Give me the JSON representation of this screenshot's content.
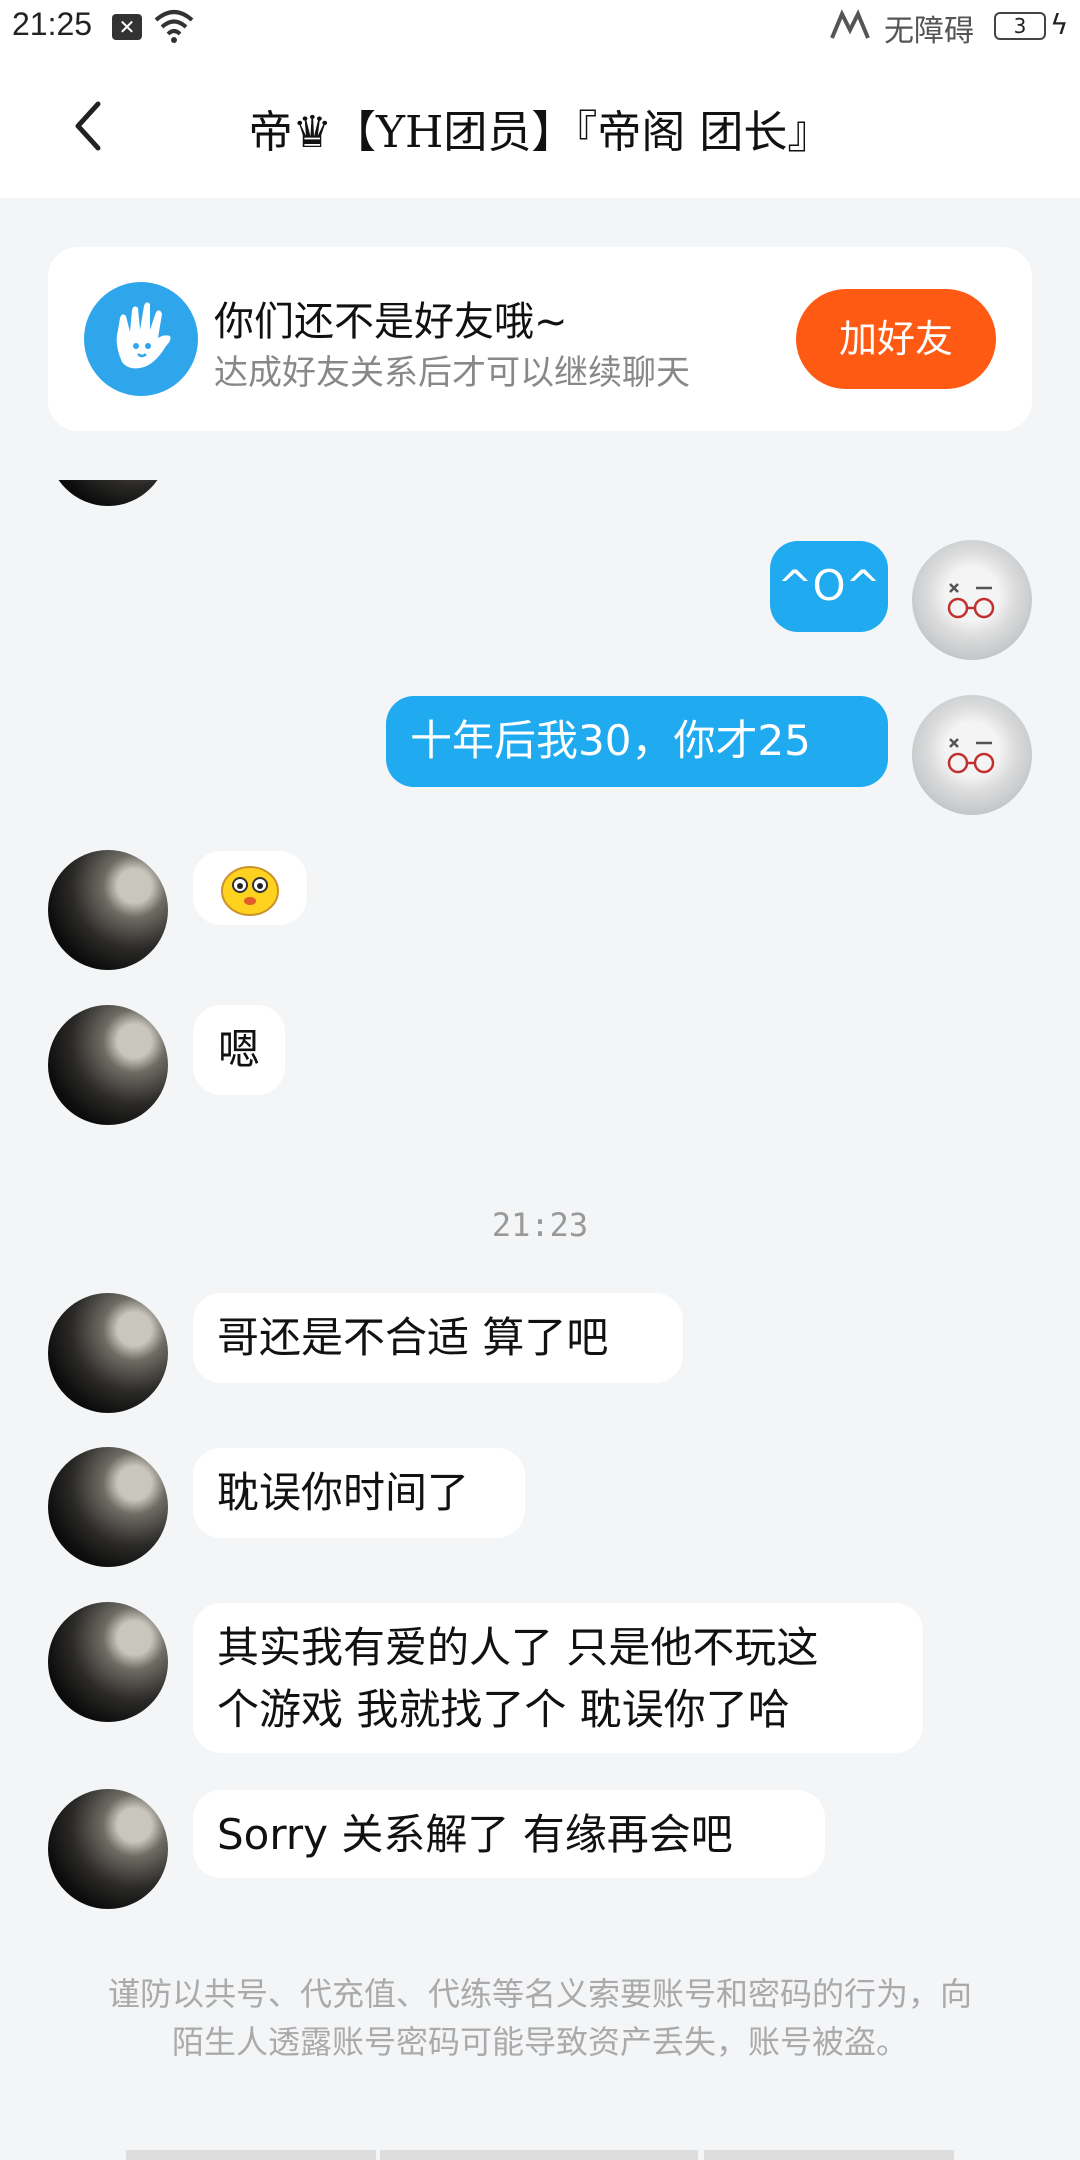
{
  "status_bar": {
    "time": "21:25",
    "notification_glyph": "✕",
    "accessibility_label": "无障碍",
    "battery_level": "3",
    "charging_glyph": "ϟ"
  },
  "header": {
    "title": "帝♛【YH团员】『帝阁 团长』"
  },
  "banner": {
    "title": "你们还不是好友哦~",
    "subtitle": "达成好友关系后才可以继续聊天",
    "add_button": "加好友"
  },
  "messages": [
    {
      "direction": "out",
      "text": "^O^"
    },
    {
      "direction": "out",
      "text": "十年后我30，你才25"
    },
    {
      "direction": "in",
      "text": "",
      "sticker": "yellow-emoji"
    },
    {
      "direction": "in",
      "text": "嗯"
    },
    {
      "direction": "in",
      "text": "哥还是不合适 算了吧"
    },
    {
      "direction": "in",
      "text": "耽误你时间了"
    },
    {
      "direction": "in",
      "text_line1": "其实我有爱的人了 只是他不玩这",
      "text_line2": "个游戏 我就找了个 耽误你了哈"
    },
    {
      "direction": "in",
      "text": "Sorry 关系解了 有缘再会吧"
    }
  ],
  "timestamp": "21:23",
  "footer_warning": "谨防以共号、代充值、代练等名义索要账号和密码的行为，向陌生人透露账号密码可能导致资产丢失，账号被盗。",
  "colors": {
    "accent_blue": "#20aaf0",
    "add_button_orange": "#ff5a14",
    "background": "#f4f5f7"
  },
  "icons": {
    "back": "chevron-left-icon",
    "banner": "waving-hand-icon",
    "wifi": "wifi-icon",
    "accessibility": "accessibility-icon",
    "battery": "battery-icon"
  }
}
